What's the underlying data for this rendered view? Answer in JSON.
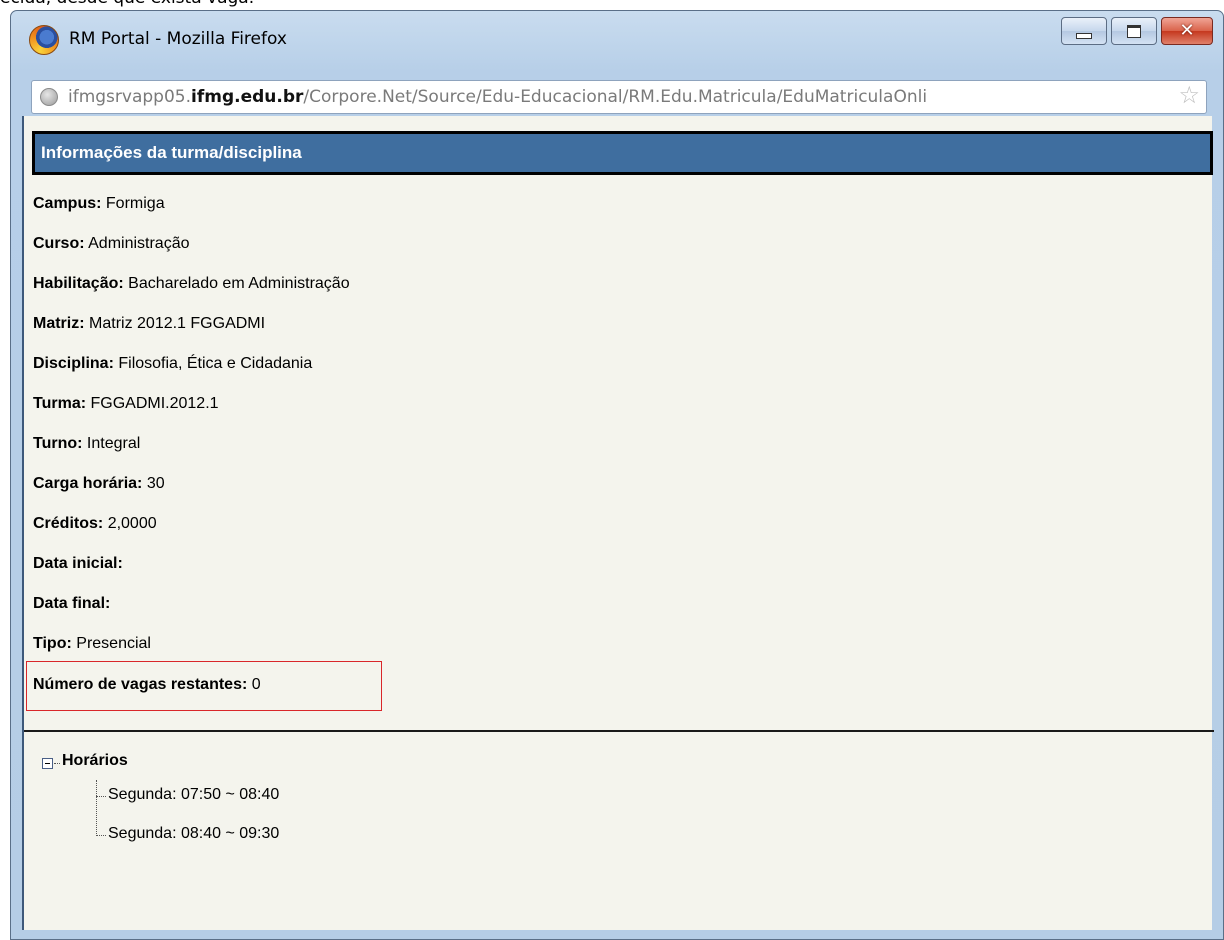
{
  "top_caption": "ecida, desde que exista vaga.",
  "window": {
    "title": "RM Portal - Mozilla Firefox"
  },
  "urlbar": {
    "host_prefix": "ifmgsrvapp05.",
    "host_domain": "ifmg.edu.br",
    "path": "/Corpore.Net/Source/Edu-Educacional/RM.Edu.Matricula/EduMatriculaOnli"
  },
  "section": {
    "header": "Informações da turma/disciplina"
  },
  "fields": [
    {
      "label": "Campus:",
      "value": "Formiga"
    },
    {
      "label": "Curso:",
      "value": "Administração"
    },
    {
      "label": "Habilitação:",
      "value": "Bacharelado em Administração"
    },
    {
      "label": "Matriz:",
      "value": "Matriz 2012.1 FGGADMI"
    },
    {
      "label": "Disciplina:",
      "value": "Filosofia, Ética e Cidadania"
    },
    {
      "label": "Turma:",
      "value": "FGGADMI.2012.1"
    },
    {
      "label": "Turno:",
      "value": "Integral"
    },
    {
      "label": "Carga horária:",
      "value": "30"
    },
    {
      "label": "Créditos:",
      "value": "2,0000"
    },
    {
      "label": "Data inicial:",
      "value": ""
    },
    {
      "label": "Data final:",
      "value": ""
    },
    {
      "label": "Tipo:",
      "value": "Presencial"
    },
    {
      "label": "Número de vagas restantes:",
      "value": "0"
    }
  ],
  "horarios": {
    "label": "Horários",
    "items": [
      "Segunda: 07:50 ~ 08:40",
      "Segunda: 08:40 ~ 09:30"
    ]
  },
  "colors": {
    "header_bg": "#3f6e9f",
    "highlight_border": "#d9262a",
    "content_bg": "#f4f4ed"
  }
}
